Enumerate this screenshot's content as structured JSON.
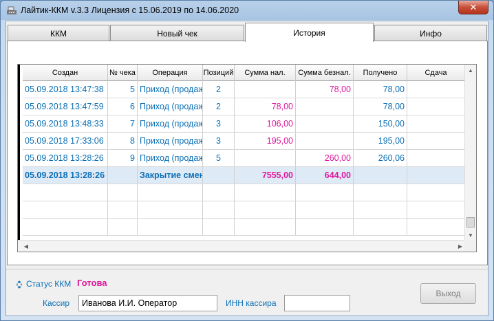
{
  "window": {
    "title": "Лайтик-ККМ v.3.3   Лицензия с 15.06.2019 по 14.06.2020",
    "close_label": "✕"
  },
  "tabs": [
    {
      "label": "ККМ",
      "active": false
    },
    {
      "label": "Новый чек",
      "active": false
    },
    {
      "label": "История",
      "active": true
    },
    {
      "label": "Инфо",
      "active": false
    }
  ],
  "grid": {
    "columns": [
      "Создан",
      "№ чека",
      "Операция",
      "Позиций",
      "Сумма нал.",
      "Сумма безнал.",
      "Получено",
      "Сдача"
    ],
    "rows": [
      {
        "created": "05.09.2018 13:47:38",
        "number": "5",
        "operation": "Приход (продажа)",
        "positions": "2",
        "cash": "",
        "cashless": "78,00",
        "received": "78,00",
        "change": ""
      },
      {
        "created": "05.09.2018 13:47:59",
        "number": "6",
        "operation": "Приход (продажа)",
        "positions": "2",
        "cash": "78,00",
        "cashless": "",
        "received": "78,00",
        "change": ""
      },
      {
        "created": "05.09.2018 13:48:33",
        "number": "7",
        "operation": "Приход (продажа)",
        "positions": "3",
        "cash": "106,00",
        "cashless": "",
        "received": "150,00",
        "change": ""
      },
      {
        "created": "05.09.2018 17:33:06",
        "number": "8",
        "operation": "Приход (продажа)",
        "positions": "3",
        "cash": "195,00",
        "cashless": "",
        "received": "195,00",
        "change": ""
      },
      {
        "created": "05.09.2018 13:28:26",
        "number": "9",
        "operation": "Приход (продажа)",
        "positions": "5",
        "cash": "",
        "cashless": "260,00",
        "received": "260,06",
        "change": ""
      }
    ],
    "total": {
      "created": "05.09.2018 13:28:26",
      "number": "",
      "operation": "Закрытие смены",
      "positions": "",
      "cash": "7555,00",
      "cashless": "644,00",
      "received": "",
      "change": ""
    }
  },
  "status": {
    "label": "Статус ККМ",
    "value": "Готова",
    "icon": "refresh-icon"
  },
  "cashier": {
    "label": "Кассир",
    "value": "Иванова И.И. Оператор"
  },
  "inn": {
    "label": "ИНН кассира",
    "value": ""
  },
  "exit_button": {
    "label": "Выход"
  },
  "colors": {
    "accent_blue": "#0a6fb5",
    "accent_pink": "#e0189e"
  }
}
